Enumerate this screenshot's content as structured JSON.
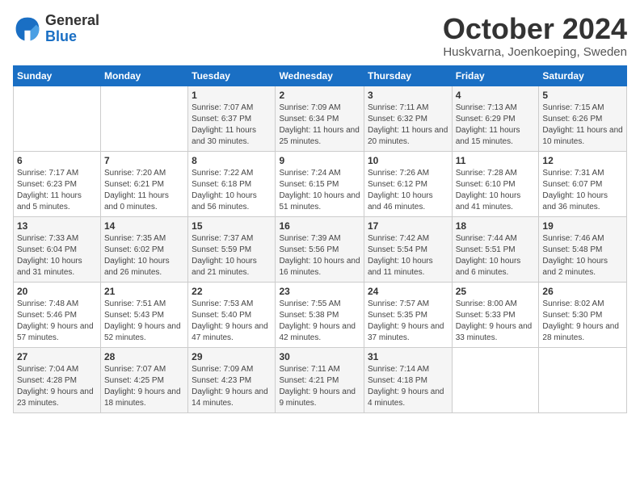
{
  "logo": {
    "general": "General",
    "blue": "Blue"
  },
  "title": "October 2024",
  "subtitle": "Huskvarna, Joenkoeping, Sweden",
  "weekdays": [
    "Sunday",
    "Monday",
    "Tuesday",
    "Wednesday",
    "Thursday",
    "Friday",
    "Saturday"
  ],
  "weeks": [
    [
      {
        "num": "",
        "info": ""
      },
      {
        "num": "",
        "info": ""
      },
      {
        "num": "1",
        "info": "Sunrise: 7:07 AM\nSunset: 6:37 PM\nDaylight: 11 hours and 30 minutes."
      },
      {
        "num": "2",
        "info": "Sunrise: 7:09 AM\nSunset: 6:34 PM\nDaylight: 11 hours and 25 minutes."
      },
      {
        "num": "3",
        "info": "Sunrise: 7:11 AM\nSunset: 6:32 PM\nDaylight: 11 hours and 20 minutes."
      },
      {
        "num": "4",
        "info": "Sunrise: 7:13 AM\nSunset: 6:29 PM\nDaylight: 11 hours and 15 minutes."
      },
      {
        "num": "5",
        "info": "Sunrise: 7:15 AM\nSunset: 6:26 PM\nDaylight: 11 hours and 10 minutes."
      }
    ],
    [
      {
        "num": "6",
        "info": "Sunrise: 7:17 AM\nSunset: 6:23 PM\nDaylight: 11 hours and 5 minutes."
      },
      {
        "num": "7",
        "info": "Sunrise: 7:20 AM\nSunset: 6:21 PM\nDaylight: 11 hours and 0 minutes."
      },
      {
        "num": "8",
        "info": "Sunrise: 7:22 AM\nSunset: 6:18 PM\nDaylight: 10 hours and 56 minutes."
      },
      {
        "num": "9",
        "info": "Sunrise: 7:24 AM\nSunset: 6:15 PM\nDaylight: 10 hours and 51 minutes."
      },
      {
        "num": "10",
        "info": "Sunrise: 7:26 AM\nSunset: 6:12 PM\nDaylight: 10 hours and 46 minutes."
      },
      {
        "num": "11",
        "info": "Sunrise: 7:28 AM\nSunset: 6:10 PM\nDaylight: 10 hours and 41 minutes."
      },
      {
        "num": "12",
        "info": "Sunrise: 7:31 AM\nSunset: 6:07 PM\nDaylight: 10 hours and 36 minutes."
      }
    ],
    [
      {
        "num": "13",
        "info": "Sunrise: 7:33 AM\nSunset: 6:04 PM\nDaylight: 10 hours and 31 minutes."
      },
      {
        "num": "14",
        "info": "Sunrise: 7:35 AM\nSunset: 6:02 PM\nDaylight: 10 hours and 26 minutes."
      },
      {
        "num": "15",
        "info": "Sunrise: 7:37 AM\nSunset: 5:59 PM\nDaylight: 10 hours and 21 minutes."
      },
      {
        "num": "16",
        "info": "Sunrise: 7:39 AM\nSunset: 5:56 PM\nDaylight: 10 hours and 16 minutes."
      },
      {
        "num": "17",
        "info": "Sunrise: 7:42 AM\nSunset: 5:54 PM\nDaylight: 10 hours and 11 minutes."
      },
      {
        "num": "18",
        "info": "Sunrise: 7:44 AM\nSunset: 5:51 PM\nDaylight: 10 hours and 6 minutes."
      },
      {
        "num": "19",
        "info": "Sunrise: 7:46 AM\nSunset: 5:48 PM\nDaylight: 10 hours and 2 minutes."
      }
    ],
    [
      {
        "num": "20",
        "info": "Sunrise: 7:48 AM\nSunset: 5:46 PM\nDaylight: 9 hours and 57 minutes."
      },
      {
        "num": "21",
        "info": "Sunrise: 7:51 AM\nSunset: 5:43 PM\nDaylight: 9 hours and 52 minutes."
      },
      {
        "num": "22",
        "info": "Sunrise: 7:53 AM\nSunset: 5:40 PM\nDaylight: 9 hours and 47 minutes."
      },
      {
        "num": "23",
        "info": "Sunrise: 7:55 AM\nSunset: 5:38 PM\nDaylight: 9 hours and 42 minutes."
      },
      {
        "num": "24",
        "info": "Sunrise: 7:57 AM\nSunset: 5:35 PM\nDaylight: 9 hours and 37 minutes."
      },
      {
        "num": "25",
        "info": "Sunrise: 8:00 AM\nSunset: 5:33 PM\nDaylight: 9 hours and 33 minutes."
      },
      {
        "num": "26",
        "info": "Sunrise: 8:02 AM\nSunset: 5:30 PM\nDaylight: 9 hours and 28 minutes."
      }
    ],
    [
      {
        "num": "27",
        "info": "Sunrise: 7:04 AM\nSunset: 4:28 PM\nDaylight: 9 hours and 23 minutes."
      },
      {
        "num": "28",
        "info": "Sunrise: 7:07 AM\nSunset: 4:25 PM\nDaylight: 9 hours and 18 minutes."
      },
      {
        "num": "29",
        "info": "Sunrise: 7:09 AM\nSunset: 4:23 PM\nDaylight: 9 hours and 14 minutes."
      },
      {
        "num": "30",
        "info": "Sunrise: 7:11 AM\nSunset: 4:21 PM\nDaylight: 9 hours and 9 minutes."
      },
      {
        "num": "31",
        "info": "Sunrise: 7:14 AM\nSunset: 4:18 PM\nDaylight: 9 hours and 4 minutes."
      },
      {
        "num": "",
        "info": ""
      },
      {
        "num": "",
        "info": ""
      }
    ]
  ]
}
